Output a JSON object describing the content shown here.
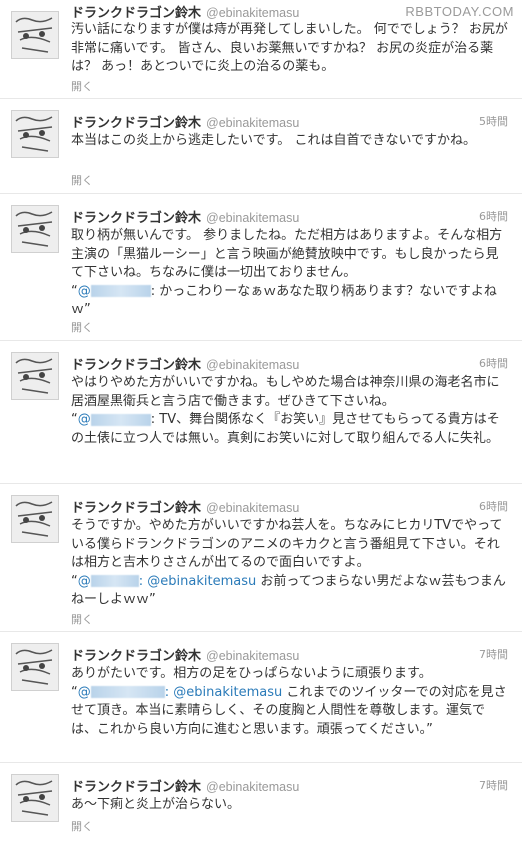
{
  "watermark": "RBBTODAY.COM",
  "tweets": [
    {
      "name": "ドランクドラゴン鈴木",
      "handle": "@ebinakitemasu",
      "time": "",
      "body": "汚い話になりますが僕は痔が再発してしまいした。 何ででしょう？ お尻が非常に痛いです。 皆さん、良いお薬無いですかね？ お尻の炎症が治る薬は？ あっ！あとついでに炎上の治るの薬も。",
      "expand": "開く"
    },
    {
      "name": "ドランクドラゴン鈴木",
      "handle": "@ebinakitemasu",
      "time": "5時間",
      "body": "本当はこの炎上から逃走したいです。 これは自首できないですかね。",
      "expand": "開く"
    },
    {
      "name": "ドランクドラゴン鈴木",
      "handle": "@ebinakitemasu",
      "time": "6時間",
      "body": "取り柄が無いんです。 参りましたね。ただ相方はありますよ。そんな相方主演の「黒猫ルーシー」と言う映画が絶賛放映中です。もし良かったら見て下さいね。ちなみに僕は一切出ておりません。",
      "reply_prefix": "“",
      "mention_text": "",
      "reply_rest": ": かっこわりーなぁｗあなた取り柄あります？ないですよねｗ”",
      "expand": "開く"
    },
    {
      "name": "ドランクドラゴン鈴木",
      "handle": "@ebinakitemasu",
      "time": "6時間",
      "body": "やはりやめた方がいいですかね。もしやめた場合は神奈川県の海老名市に居酒屋黒衛兵と言う店で働きます。ぜひきて下さいね。",
      "reply_prefix": "“",
      "mention_text": "",
      "reply_rest": ": TV、舞台関係なく『お笑い』見させてもらってる貴方はその土俵に立つ人では無い。真剣にお笑いに対して取り組んでる人に失礼。",
      "expand": "開く"
    },
    {
      "name": "ドランクドラゴン鈴木",
      "handle": "@ebinakitemasu",
      "time": "6時間",
      "body": "そうですか。やめた方がいいですかね芸人を。ちなみにヒカリTVでやっている僕らドランクドラゴンのアニメのキカクと言う番組見て下さい。それは相方と吉木りささんが出てるので面白いですよ。",
      "reply_prefix": "“",
      "mention_text": ": @ebinakitemasu",
      "reply_rest": " お前ってつまらない男だよなｗ芸もつまんねーしよｗｗ”",
      "expand": "開く"
    },
    {
      "name": "ドランクドラゴン鈴木",
      "handle": "@ebinakitemasu",
      "time": "7時間",
      "body": "ありがたいです。相方の足をひっぱらないように頑張ります。",
      "reply_prefix": "“",
      "mention_text": ": @ebinakitemasu",
      "reply_rest": " これまでのツイッターでの対応を見させて頂き。本当に素晴らしく、その度胸と人間性を尊敬します。運気では、これから良い方向に進むと思います。頑張ってください。”",
      "expand": "開く"
    },
    {
      "name": "ドランクドラゴン鈴木",
      "handle": "@ebinakitemasu",
      "time": "7時間",
      "body": "あ〜下痢と炎上が治らない。",
      "expand": "開く"
    }
  ]
}
